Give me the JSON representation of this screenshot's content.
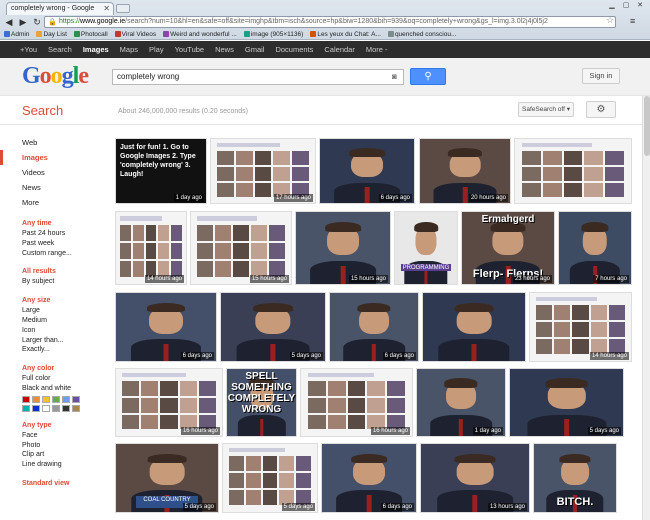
{
  "browser": {
    "tab_title": "completely wrong - Google",
    "url_prefix": "https://",
    "url_host": "www.google.ie",
    "url_rest": "/search?num=10&hl=en&safe=off&site=imghp&tbm=isch&source=hp&biw=1280&bih=939&oq=completely+wrong&gs_l=img.3.0l2j4j0l5j2",
    "bookmarks": [
      "Admin",
      "Day List",
      "Photocall",
      "Viral Videos",
      "Weird and wonderful ...",
      "image (905×1136)",
      "Les yeux du Chat: A...",
      "quenched consciou..."
    ]
  },
  "gbar": {
    "items": [
      "+You",
      "Search",
      "Images",
      "Maps",
      "Play",
      "YouTube",
      "News",
      "Gmail",
      "Documents",
      "Calendar",
      "More -"
    ],
    "active_index": 2
  },
  "header": {
    "logo": "Google",
    "query": "completely wrong",
    "sign_in": "Sign in"
  },
  "brand_label": "Search",
  "result_stats": "About 246,000,000 results (0.20 seconds)",
  "safesearch": "SafeSearch off ▾",
  "left_nav": {
    "items": [
      "Web",
      "Images",
      "Videos",
      "News",
      "More"
    ],
    "active_index": 1
  },
  "filters": [
    {
      "heading": "Any time",
      "items": [
        "Past 24 hours",
        "Past week",
        "Custom range..."
      ]
    },
    {
      "heading": "All results",
      "items": [
        "By subject"
      ]
    },
    {
      "heading": "Any size",
      "items": [
        "Large",
        "Medium",
        "Icon",
        "Larger than...",
        "Exactly..."
      ]
    },
    {
      "heading": "Any color",
      "items": [
        "Full color",
        "Black and white"
      ]
    },
    {
      "heading": "Any type",
      "items": [
        "Face",
        "Photo",
        "Clip art",
        "Line drawing"
      ]
    },
    {
      "heading": "Standard view",
      "items": []
    }
  ],
  "colors": {
    "accent": "#dd4b39",
    "search_blue": "#4d90fe",
    "gbar": "#2d2d2d",
    "swatches": [
      "#cc0000",
      "#e69138",
      "#f1c232",
      "#6aa84f",
      "#6d9eeb",
      "#674ea7",
      "#00b3b3",
      "#0b2fd6",
      "#ffffff",
      "#999999",
      "#333333",
      "#a6864d"
    ]
  },
  "images": [
    {
      "caption": "1 day ago",
      "style": "text",
      "text": "Just for fun! 1. Go to Google Images 2. Type 'completely wrong' 3. Laugh!"
    },
    {
      "caption": "17 hours ago",
      "style": "shot"
    },
    {
      "caption": "6 days ago",
      "style": "face"
    },
    {
      "caption": "20 hours ago",
      "style": "face"
    },
    {
      "caption": "",
      "style": "shot"
    },
    {
      "caption": "14 hours ago",
      "style": "shot"
    },
    {
      "caption": "15 hours ago",
      "style": "shot"
    },
    {
      "caption": "15 hours ago",
      "style": "face"
    },
    {
      "caption": "",
      "style": "programming",
      "text": "PROGRAMMING"
    },
    {
      "caption": "23 hours ago",
      "style": "meme",
      "top": "Ermahgerd",
      "bottom": "Flerp- Flerps!"
    },
    {
      "caption": "7 hours ago",
      "style": "face"
    },
    {
      "caption": "6 days ago",
      "style": "face"
    },
    {
      "caption": "5 days ago",
      "style": "face"
    },
    {
      "caption": "6 days ago",
      "style": "face"
    },
    {
      "caption": "",
      "style": "face"
    },
    {
      "caption": "14 hours ago",
      "style": "shot"
    },
    {
      "caption": "16 hours ago",
      "style": "shot"
    },
    {
      "caption": "",
      "style": "meme",
      "top": "SPELL SOMETHING COMPLETELY WRONG",
      "bottom": ""
    },
    {
      "caption": "16 hours ago",
      "style": "shot"
    },
    {
      "caption": "1 day ago",
      "style": "face"
    },
    {
      "caption": "5 days ago",
      "style": "face"
    },
    {
      "caption": "5 days ago",
      "style": "podium",
      "text": "COAL COUNTRY"
    },
    {
      "caption": "5 days ago",
      "style": "shot"
    },
    {
      "caption": "6 days ago",
      "style": "face"
    },
    {
      "caption": "13 hours ago",
      "style": "face"
    },
    {
      "caption": "",
      "style": "meme",
      "top": "",
      "bottom": "BITCH."
    }
  ]
}
